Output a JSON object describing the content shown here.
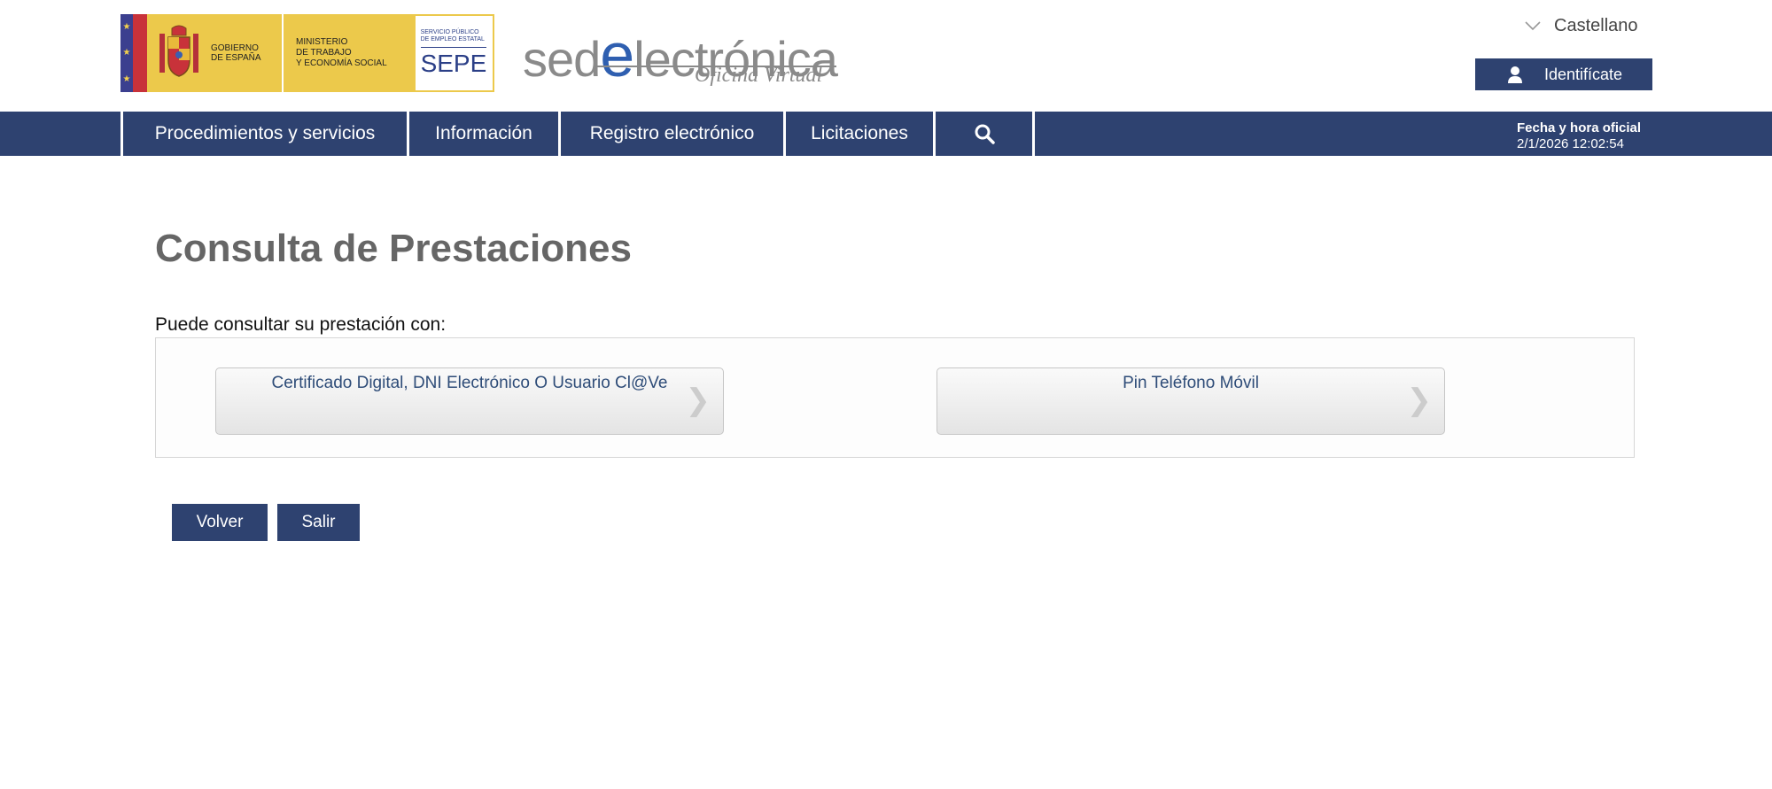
{
  "header": {
    "gov_line1": "GOBIERNO",
    "gov_line2": "DE ESPAÑA",
    "min_line1": "MINISTERIO",
    "min_line2": "DE TRABAJO",
    "min_line3": "Y ECONOMÍA SOCIAL",
    "sepe_small1": "SERVICIO PÚBLICO",
    "sepe_small2": "DE EMPLEO ESTATAL",
    "sepe_name": "SEPE",
    "sede_pre": "sed",
    "sede_e": "e",
    "sede_post": "lectrónica",
    "sede_sub": "Oficina Virtual",
    "language": "Castellano",
    "login_label": "Identifícate"
  },
  "nav": {
    "items": [
      {
        "label": "Procedimientos y servicios"
      },
      {
        "label": "Información"
      },
      {
        "label": "Registro electrónico"
      },
      {
        "label": "Licitaciones"
      }
    ],
    "fecha_label": "Fecha y hora oficial",
    "fecha_value": "2/1/2026 12:02:54"
  },
  "main": {
    "title": "Consulta de Prestaciones",
    "intro": "Puede consultar su prestación con:",
    "options": [
      {
        "label": "Certificado Digital, DNI Electrónico O Usuario Cl@Ve"
      },
      {
        "label": "Pin Teléfono Móvil"
      }
    ],
    "back_label": "Volver",
    "exit_label": "Salir"
  }
}
